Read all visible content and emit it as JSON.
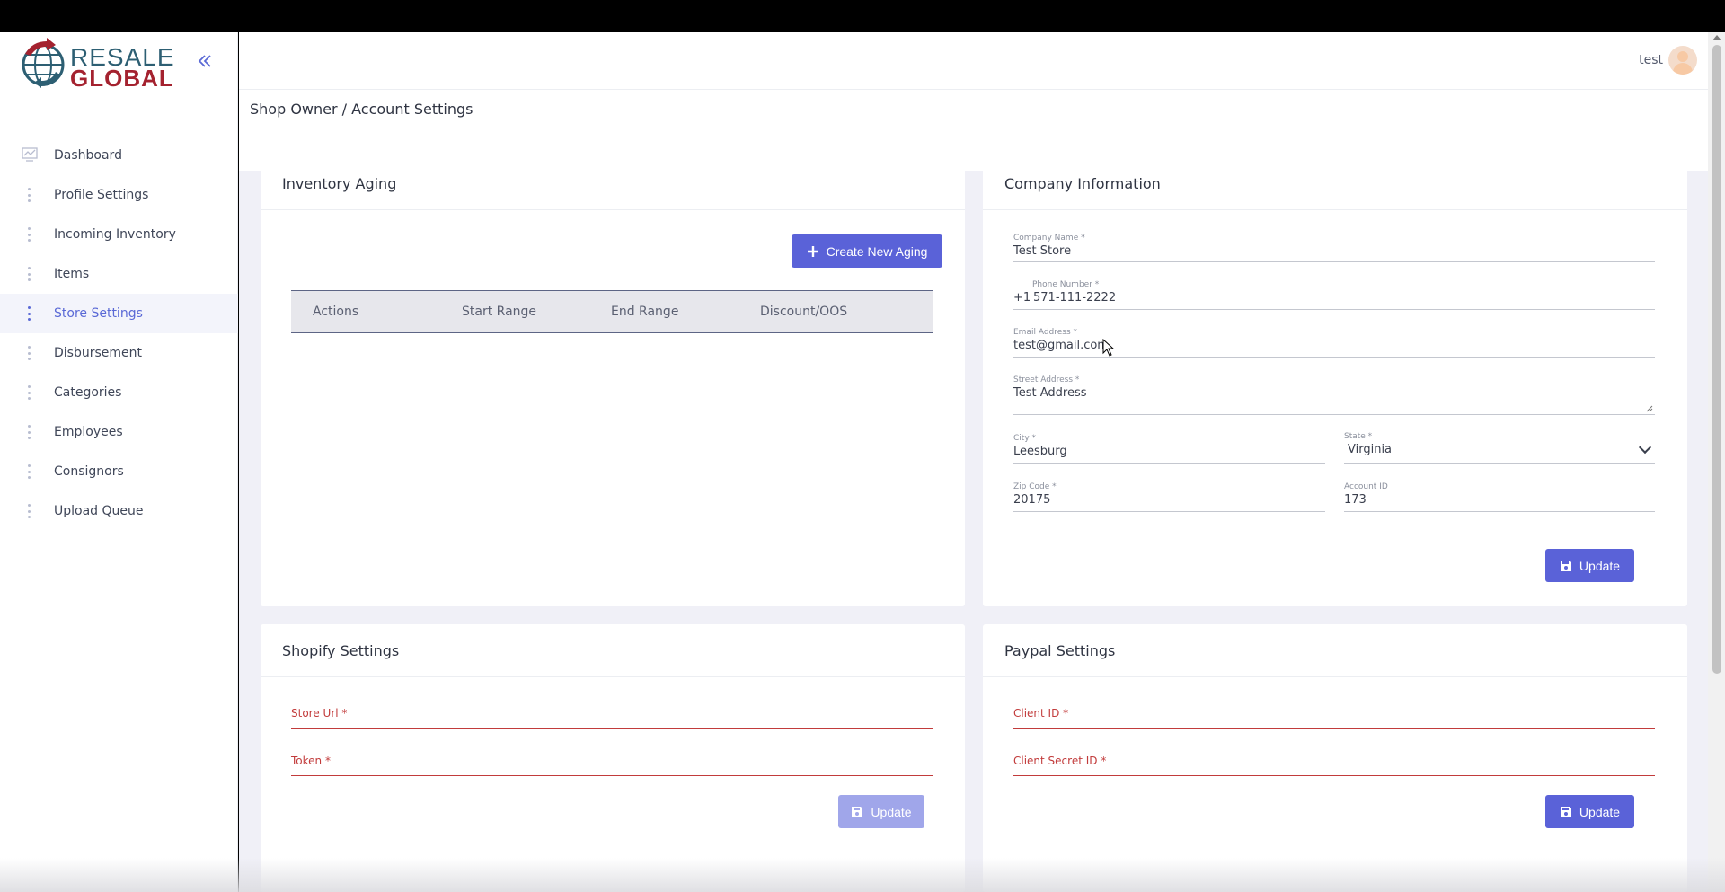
{
  "brand": {
    "line1": "RESALE",
    "line2": "GLOBAL",
    "primary": "#5a62d8",
    "danger": "#c23b3b"
  },
  "sidebar": {
    "collapse_icon": "double-chevron-left-icon",
    "items": [
      {
        "label": "Dashboard",
        "icon": "chart-icon"
      },
      {
        "label": "Profile Settings",
        "icon": "dots-icon"
      },
      {
        "label": "Incoming Inventory",
        "icon": "dots-icon"
      },
      {
        "label": "Items",
        "icon": "dots-icon"
      },
      {
        "label": "Store Settings",
        "icon": "dots-icon",
        "active": true
      },
      {
        "label": "Disbursement",
        "icon": "dots-icon"
      },
      {
        "label": "Categories",
        "icon": "dots-icon"
      },
      {
        "label": "Employees",
        "icon": "dots-icon"
      },
      {
        "label": "Consignors",
        "icon": "dots-icon"
      },
      {
        "label": "Upload Queue",
        "icon": "dots-icon"
      }
    ]
  },
  "header": {
    "user_name": "test"
  },
  "breadcrumb": "Shop Owner / Account Settings",
  "inventory_aging": {
    "title": "Inventory Aging",
    "create_label": "Create New Aging",
    "columns": [
      "Actions",
      "Start Range",
      "End Range",
      "Discount/OOS"
    ]
  },
  "company": {
    "title": "Company Information",
    "company_name_label": "Company Name *",
    "company_name": "Test Store",
    "phone_label": "Phone Number *",
    "phone_prefix": "+1",
    "phone": "571-111-2222",
    "email_label": "Email Address *",
    "email": "test@gmail.com",
    "street_label": "Street Address *",
    "street": "Test Address",
    "city_label": "City *",
    "city": "Leesburg",
    "state_label": "State *",
    "state": "Virginia",
    "zip_label": "Zip Code *",
    "zip": "20175",
    "account_label": "Account ID",
    "account": "173",
    "update_label": "Update"
  },
  "shopify": {
    "title": "Shopify Settings",
    "store_url_label": "Store Url *",
    "token_label": "Token *",
    "update_label": "Update"
  },
  "paypal": {
    "title": "Paypal Settings",
    "client_id_label": "Client ID *",
    "client_secret_label": "Client Secret ID *",
    "update_label": "Update"
  }
}
